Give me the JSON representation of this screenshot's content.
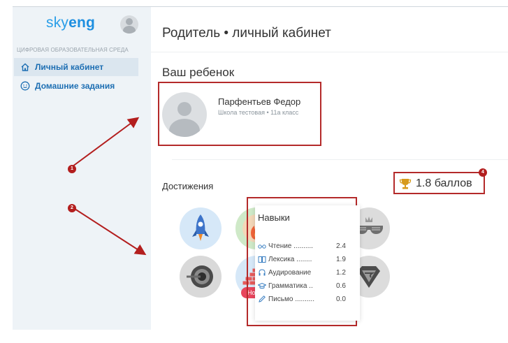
{
  "sidebar": {
    "logo_part1": "sky",
    "logo_part2": "eng",
    "caption": "ЦИФРОВАЯ ОБРАЗОВАТЕЛЬНАЯ СРЕДА",
    "items": [
      {
        "label": "Личный кабинет",
        "icon": "home-icon",
        "active": true
      },
      {
        "label": "Домашние задания",
        "icon": "smile-icon",
        "active": false
      }
    ]
  },
  "main": {
    "title": "Родитель • личный кабинет",
    "child_heading": "Ваш ребенок",
    "child": {
      "name": "Парфентьев Федор",
      "school": "Школа тестовая • 11а класс"
    },
    "achievements_heading": "Достижения",
    "score": "1.8 баллов",
    "new_tag": "Новая",
    "skills": {
      "title": "Навыки",
      "rows": [
        {
          "label": "Чтение",
          "dots": "..........",
          "value": "2.4",
          "icon": "glasses-icon"
        },
        {
          "label": "Лексика",
          "dots": "........",
          "value": "1.9",
          "icon": "book-icon"
        },
        {
          "label": "Аудирование",
          "dots": "",
          "value": "1.2",
          "icon": "headphones-icon"
        },
        {
          "label": "Грамматика",
          "dots": "..",
          "value": "0.6",
          "icon": "grad-cap-icon"
        },
        {
          "label": "Письмо",
          "dots": "..........",
          "value": "0.0",
          "icon": "pencil-icon"
        }
      ]
    }
  },
  "markers": [
    "1",
    "2",
    "4"
  ],
  "colors": {
    "accent": "#1e8fe0",
    "annotation": "#b42a2a",
    "new_badge": "#e8455c"
  }
}
